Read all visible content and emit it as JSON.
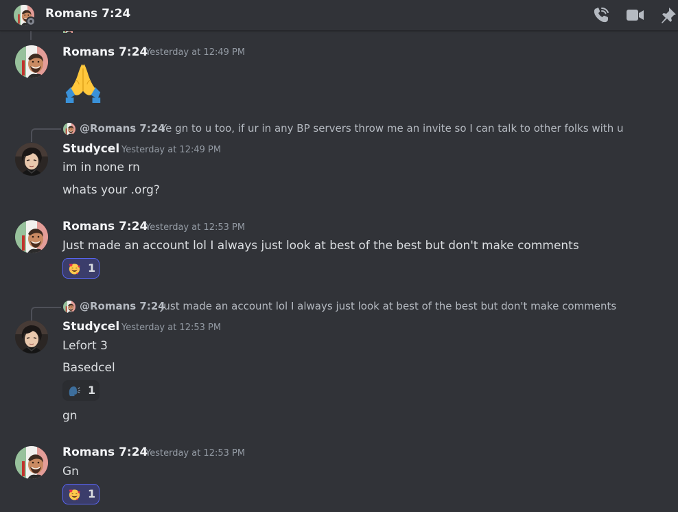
{
  "header": {
    "title": "Romans 7:24",
    "icons": [
      "phone-call-icon",
      "video-camera-icon",
      "pin-icon"
    ]
  },
  "messages": [
    {
      "author": "Romans 7:24",
      "timestamp": "Yesterday at 12:49 PM",
      "emoji_message": "folded-hands-emoji"
    },
    {
      "reply_to": {
        "mention": "@Romans 7:24",
        "text": "Ye gn to u too, if ur in any BP servers throw me an invite so I can talk to other folks with u"
      },
      "author": "Studycel",
      "timestamp": "Yesterday at 12:49 PM",
      "lines": [
        "im in none rn",
        "whats your .org?"
      ]
    },
    {
      "author": "Romans 7:24",
      "timestamp": "Yesterday at 12:53 PM",
      "lines": [
        "Just made an account lol I always just look at best of the best but don't make comments"
      ],
      "reaction": {
        "emoji": "smiling-face-with-hearts",
        "count": "1",
        "active": true
      }
    },
    {
      "reply_to": {
        "mention": "@Romans 7:24",
        "text": "Just made an account lol I always just look at best of the best but don't make comments"
      },
      "author": "Studycel",
      "timestamp": "Yesterday at 12:53 PM",
      "lines": [
        "Lefort 3",
        "Basedcel",
        "gn"
      ],
      "reaction": {
        "emoji": "speaking-head",
        "count": "1",
        "active": false
      }
    },
    {
      "author": "Romans 7:24",
      "timestamp": "Yesterday at 12:53 PM",
      "lines": [
        "Gn"
      ],
      "reaction": {
        "emoji": "smiling-face-with-hearts",
        "count": "1",
        "active": true
      }
    }
  ],
  "colors": {
    "background": "#313338",
    "username": "#f2f3f5",
    "timestamp": "#949ba4",
    "text": "#dbdee1",
    "reaction_active_border": "#5865f2"
  }
}
